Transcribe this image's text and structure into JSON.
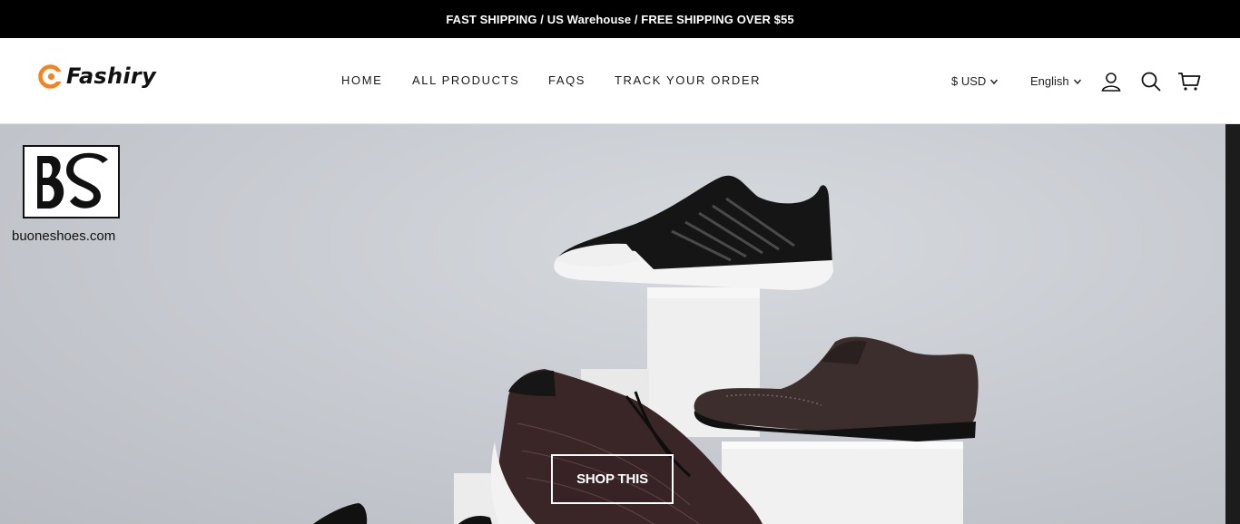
{
  "announcement": {
    "text": "FAST SHIPPING / US Warehouse / FREE SHIPPING OVER $55"
  },
  "header": {
    "logo_text": "Fashiry",
    "nav": [
      {
        "label": "HOME"
      },
      {
        "label": "ALL PRODUCTS"
      },
      {
        "label": "FAQS"
      },
      {
        "label": "TRACK YOUR ORDER"
      }
    ],
    "currency": "$ USD",
    "language": "English",
    "icons": [
      "account-icon",
      "search-icon",
      "cart-icon"
    ]
  },
  "hero": {
    "watermark_text": "buoneshoes.com",
    "watermark_logo": "BS",
    "cta_label": "SHOP THIS"
  },
  "colors": {
    "brand_orange": "#f5821f",
    "topbar": "#000000",
    "text": "#111111"
  }
}
